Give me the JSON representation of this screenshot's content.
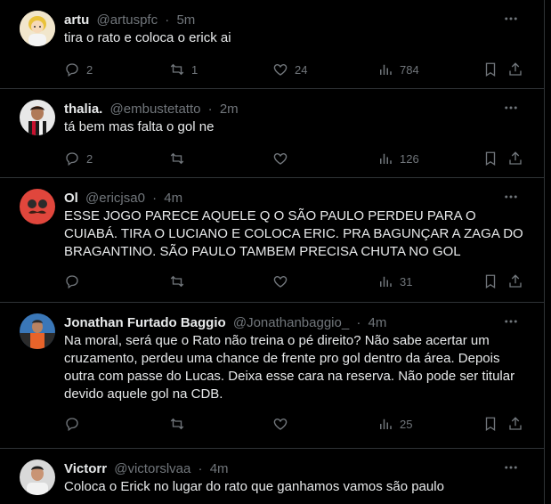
{
  "colors": {
    "background": "#000000",
    "text": "#e7e9ea",
    "muted": "#71767b",
    "border": "#2f3336"
  },
  "tweets": [
    {
      "name": "artu",
      "handle": "@artuspfc",
      "time": "5m",
      "text": "tira o rato e coloca o erick ai",
      "replies": "2",
      "retweets": "1",
      "likes": "24",
      "views": "784"
    },
    {
      "name": "thalia.",
      "handle": "@embustetatto",
      "time": "2m",
      "text": "tá bem mas falta o gol ne",
      "replies": "2",
      "retweets": "",
      "likes": "",
      "views": "126"
    },
    {
      "name": "Ol",
      "handle": "@ericjsa0",
      "time": "4m",
      "text": "ESSE JOGO PARECE AQUELE Q O SÃO PAULO PERDEU PARA O CUIABÁ. TIRA O LUCIANO E COLOCA ERIC. PRA BAGUNÇAR A ZAGA DO BRAGANTINO. SÃO PAULO TAMBEM PRECISA CHUTA NO GOL",
      "replies": "",
      "retweets": "",
      "likes": "",
      "views": "31"
    },
    {
      "name": "Jonathan Furtado Baggio",
      "handle": "@Jonathanbaggio_",
      "time": "4m",
      "text": "Na moral, será que o Rato não treina o pé direito? Não sabe acertar um cruzamento, perdeu uma chance de frente pro gol dentro da área. Depois outra com passe do Lucas. Deixa esse cara na reserva. Não pode ser titular devido aquele gol na CDB.",
      "replies": "",
      "retweets": "",
      "likes": "",
      "views": "25"
    },
    {
      "name": "Victorr",
      "handle": "@victorslvaa",
      "time": "4m",
      "text": "Coloca o Erick no lugar do rato que ganhamos vamos são paulo",
      "replies": "",
      "retweets": "",
      "likes": "",
      "views": ""
    }
  ],
  "separator": "·"
}
